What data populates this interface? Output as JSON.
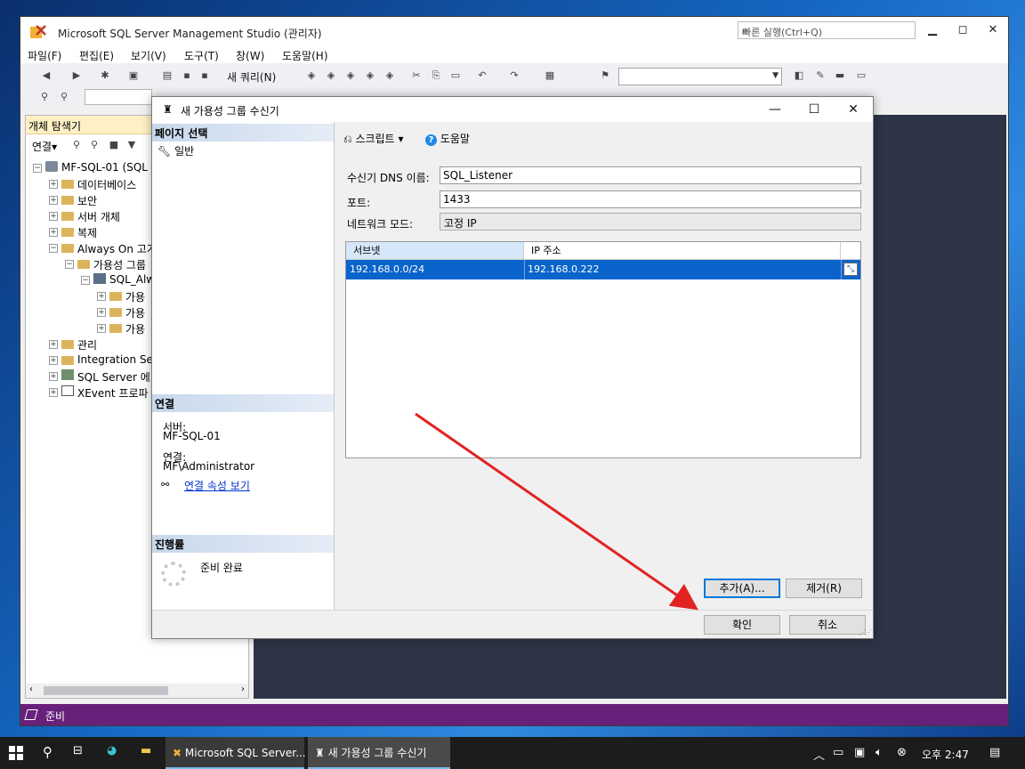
{
  "ssms": {
    "title": "Microsoft SQL Server Management Studio (관리자)",
    "quick_launch_placeholder": "빠른 실행(Ctrl+Q)",
    "menu": [
      "파일(F)",
      "편집(E)",
      "보기(V)",
      "도구(T)",
      "창(W)",
      "도움말(H)"
    ],
    "toolbar": {
      "new_query": "새 쿼리(N)"
    },
    "status": "준비"
  },
  "object_explorer": {
    "title": "개체 탐색기",
    "connect_label": "연결",
    "tree": [
      {
        "label": "MF-SQL-01 (SQL",
        "level": 0,
        "expanded": true,
        "icon": "server-icon"
      },
      {
        "label": "데이터베이스",
        "level": 1,
        "expanded": false,
        "icon": "folder-icon"
      },
      {
        "label": "보안",
        "level": 1,
        "expanded": false,
        "icon": "folder-icon"
      },
      {
        "label": "서버 개체",
        "level": 1,
        "expanded": false,
        "icon": "folder-icon"
      },
      {
        "label": "복제",
        "level": 1,
        "expanded": false,
        "icon": "folder-icon"
      },
      {
        "label": "Always On 고가",
        "level": 1,
        "expanded": true,
        "icon": "folder-icon"
      },
      {
        "label": "가용성 그룹",
        "level": 2,
        "expanded": true,
        "icon": "folder-icon"
      },
      {
        "label": "SQL_Alw",
        "level": 3,
        "expanded": true,
        "icon": "availability-group-icon"
      },
      {
        "label": "가용",
        "level": 4,
        "expanded": false,
        "icon": "folder-icon"
      },
      {
        "label": "가용",
        "level": 4,
        "expanded": false,
        "icon": "folder-icon"
      },
      {
        "label": "가용",
        "level": 4,
        "expanded": false,
        "icon": "folder-icon"
      },
      {
        "label": "관리",
        "level": 1,
        "expanded": false,
        "icon": "folder-icon"
      },
      {
        "label": "Integration Ser",
        "level": 1,
        "expanded": false,
        "icon": "folder-icon"
      },
      {
        "label": "SQL Server 에",
        "level": 1,
        "expanded": false,
        "icon": "agent-icon"
      },
      {
        "label": "XEvent 프로파",
        "level": 1,
        "expanded": false,
        "icon": "xevent-icon"
      }
    ]
  },
  "dialog": {
    "title": "새 가용성 그룹 수신기",
    "page_select_header": "페이지 선택",
    "page_general": "일반",
    "connection_header": "연결",
    "server_label": "서버:",
    "server_value": "MF-SQL-01",
    "connection_label": "연결:",
    "connection_value": "MF\\Administrator",
    "view_conn_props": "연결 속성 보기",
    "progress_header": "진행률",
    "progress_status": "준비 완료",
    "script_label": "스크립트",
    "help_label": "도움말",
    "dns_label": "수신기 DNS 이름:",
    "dns_value": "SQL_Listener",
    "port_label": "포트:",
    "port_value": "1433",
    "netmode_label": "네트워크 모드:",
    "netmode_value": "고정 IP",
    "grid": {
      "headers": [
        "서브넷",
        "IP 주소"
      ],
      "rows": [
        {
          "subnet": "192.168.0.0/24",
          "ip": "192.168.0.222"
        }
      ]
    },
    "add_label": "추가(A)...",
    "remove_label": "제거(R)",
    "ok_label": "확인",
    "cancel_label": "취소"
  },
  "taskbar": {
    "apps": [
      "Microsoft SQL Server...",
      "새 가용성 그룹 수신기"
    ],
    "clock": "오후 2:47"
  },
  "colors": {
    "status_bar": "#68217a",
    "selection": "#0a64cc",
    "arrow": "#e32222"
  }
}
